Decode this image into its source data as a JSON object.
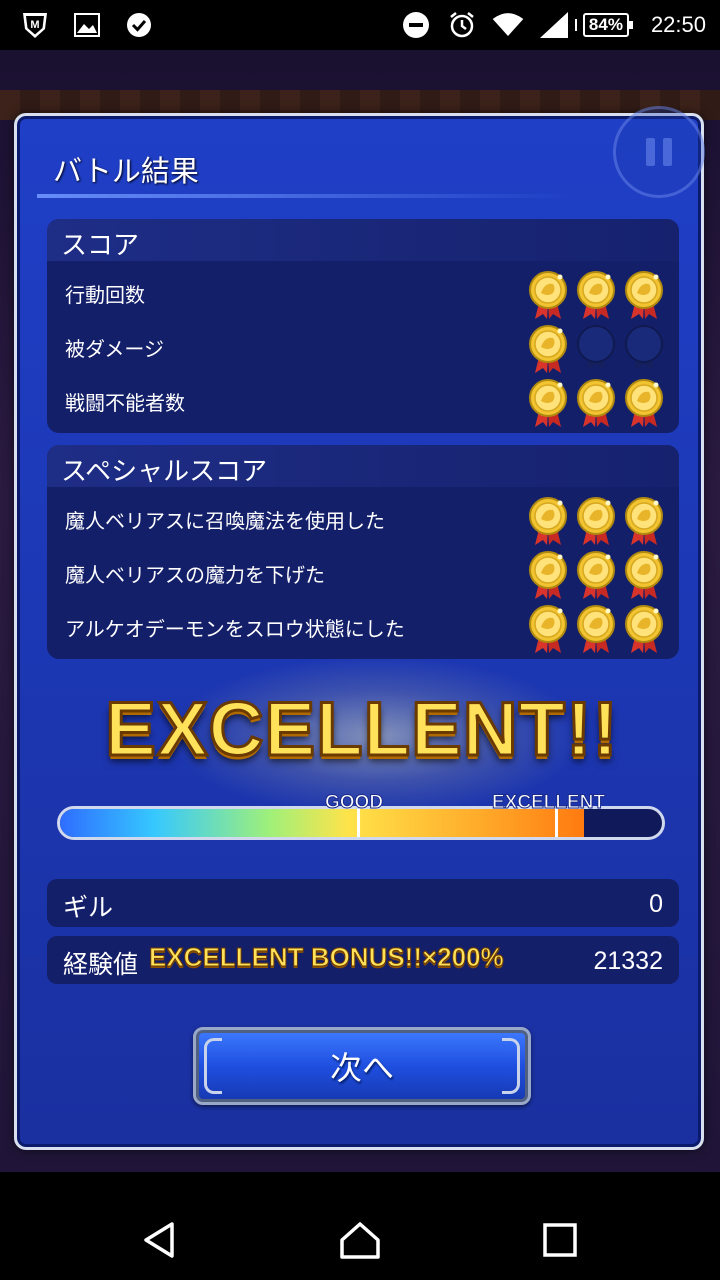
{
  "status_bar": {
    "battery": "84%",
    "time": "22:50"
  },
  "dialog": {
    "title": "バトル結果"
  },
  "score": {
    "title": "スコア",
    "rows": [
      {
        "label": "行動回数",
        "medals": 3
      },
      {
        "label": "被ダメージ",
        "medals": 1
      },
      {
        "label": "戦闘不能者数",
        "medals": 3
      }
    ]
  },
  "special_score": {
    "title": "スペシャルスコア",
    "rows": [
      {
        "label": "魔人ベリアスに召喚魔法を使用した",
        "medals": 3
      },
      {
        "label": "魔人ベリアスの魔力を下げた",
        "medals": 3
      },
      {
        "label": "アルケオデーモンをスロウ状態にした",
        "medals": 3
      }
    ]
  },
  "rank": {
    "text": "EXCELLENT!!",
    "gauge_fill": 0.87,
    "good_label": "GOOD",
    "excellent_label": "EXCELLENT"
  },
  "rewards": {
    "gil_label": "ギル",
    "gil_value": "0",
    "exp_label": "経験値",
    "exp_bonus": "EXCELLENT BONUS!!×200%",
    "exp_value": "21332"
  },
  "next_button": {
    "label": "次へ"
  },
  "colors": {
    "dialog_bg": "#1f3fc7",
    "panel_bg": "#141f6a",
    "medal_gold": "#f2c431",
    "medal_empty": "#1a2a7a",
    "rank_text": "#ffe25a"
  }
}
